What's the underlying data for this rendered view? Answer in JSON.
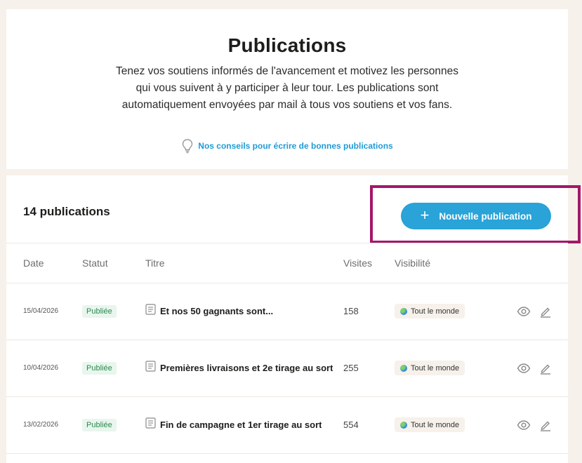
{
  "header": {
    "title": "Publications",
    "description": "Tenez vos soutiens informés de l'avancement et motivez les personnes qui vous suivent à y participer à leur tour. Les publications sont automatiquement envoyées par mail à tous vos soutiens et vos fans.",
    "tips_link": "Nos conseils pour écrire de bonnes publications"
  },
  "list": {
    "count_label": "14 publications",
    "new_button_label": "Nouvelle publication",
    "columns": {
      "date": "Date",
      "status": "Statut",
      "title": "Titre",
      "visits": "Visites",
      "visibility": "Visibilité"
    },
    "rows": [
      {
        "date": "15/04/2026",
        "status": "Publiée",
        "title": "Et nos 50 gagnants sont...",
        "visits": "158",
        "visibility": "Tout le monde"
      },
      {
        "date": "10/04/2026",
        "status": "Publiée",
        "title": "Premières livraisons et 2e tirage au sort",
        "visits": "255",
        "visibility": "Tout le monde"
      },
      {
        "date": "13/02/2026",
        "status": "Publiée",
        "title": "Fin de campagne et 1er tirage au sort",
        "visits": "554",
        "visibility": "Tout le monde"
      }
    ]
  },
  "colors": {
    "accent": "#29a3d8",
    "link": "#1e9bd7",
    "highlight": "#a3176a",
    "status_bg": "#e8f6ed",
    "status_text": "#2c8a4f",
    "page_bg": "#f6f1ea"
  }
}
